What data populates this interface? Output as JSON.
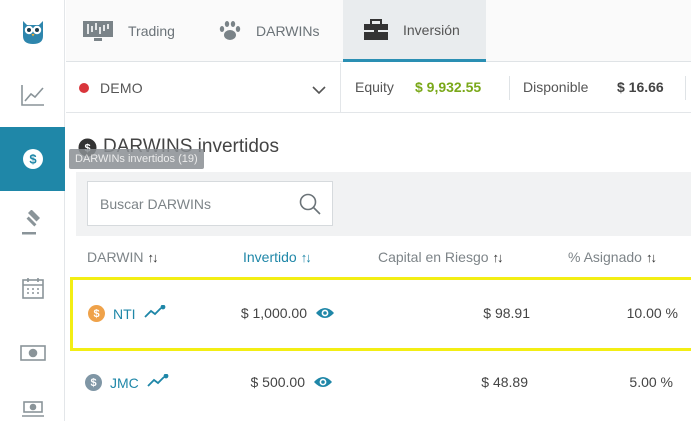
{
  "sidebar": {
    "items": [
      {
        "name": "logo-owl-icon"
      },
      {
        "name": "chart-line-icon"
      },
      {
        "name": "dollar-icon",
        "active": true
      },
      {
        "name": "gavel-icon"
      },
      {
        "name": "calendar-icon"
      },
      {
        "name": "money-bill-icon"
      },
      {
        "name": "money-hand-icon"
      }
    ],
    "active_color": "#1f87a8"
  },
  "tabs": [
    {
      "label": "Trading",
      "icon": "monitor-chart-icon"
    },
    {
      "label": "DARWINs",
      "icon": "paw-icon"
    },
    {
      "label": "Inversión",
      "icon": "briefcase-icon",
      "active": true
    }
  ],
  "account": {
    "name": "DEMO",
    "status_color": "#d9353b",
    "equity_label": "Equity",
    "equity_value": "$ 9,932.55",
    "equity_color": "#7aa819",
    "available_label": "Disponible",
    "available_value": "$ 16.66"
  },
  "section": {
    "title": "DARWINS invertidos",
    "tooltip": "DARWINs invertidos (19)"
  },
  "search": {
    "placeholder": "Buscar DARWINs"
  },
  "table": {
    "headers": {
      "darwin": "DARWIN",
      "invested": "Invertido",
      "capital_at_risk": "Capital en Riesgo",
      "allocated": "% Asignado"
    },
    "rows": [
      {
        "name": "NTI",
        "coin_color": "#efa24a",
        "invested": "$ 1,000.00",
        "capital_at_risk": "$ 98.91",
        "allocated": "10.00 %",
        "highlighted": true
      },
      {
        "name": "JMC",
        "coin_color": "#7f96a5",
        "invested": "$ 500.00",
        "capital_at_risk": "$ 48.89",
        "allocated": "5.00 %",
        "highlighted": false
      }
    ]
  }
}
